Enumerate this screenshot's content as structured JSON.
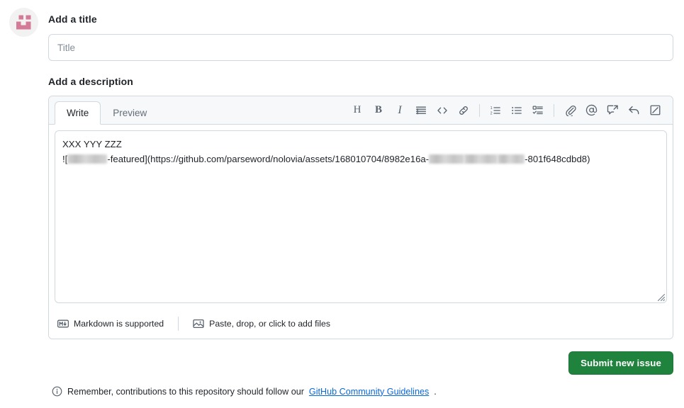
{
  "avatar": {
    "icon": "repository-owner-avatar",
    "bg_color": "#f3f2f2",
    "mark_color": "#d47b97"
  },
  "title_section": {
    "label": "Add a title",
    "input": {
      "value": "",
      "placeholder": "Title",
      "name": "issue-title-input"
    }
  },
  "description_section": {
    "label": "Add a description",
    "tabs": [
      {
        "label": "Write",
        "active": true
      },
      {
        "label": "Preview",
        "active": false
      }
    ],
    "toolbar": [
      {
        "name": "heading-icon",
        "glyph": "H",
        "kind": "letter"
      },
      {
        "name": "bold-icon",
        "glyph": "B",
        "kind": "letter-bold"
      },
      {
        "name": "italic-icon",
        "glyph": "I",
        "kind": "letter-italic"
      },
      {
        "name": "quote-icon",
        "kind": "svg"
      },
      {
        "name": "code-icon",
        "kind": "svg"
      },
      {
        "name": "link-icon",
        "kind": "svg"
      },
      {
        "name": "separator",
        "kind": "sep"
      },
      {
        "name": "ordered-list-icon",
        "kind": "svg"
      },
      {
        "name": "unordered-list-icon",
        "kind": "svg"
      },
      {
        "name": "task-list-icon",
        "kind": "svg"
      },
      {
        "name": "separator",
        "kind": "sep"
      },
      {
        "name": "attach-files-icon",
        "kind": "svg"
      },
      {
        "name": "mention-icon",
        "kind": "svg"
      },
      {
        "name": "saved-replies-icon",
        "kind": "svg"
      },
      {
        "name": "reply-icon",
        "kind": "svg"
      },
      {
        "name": "fullscreen-icon",
        "kind": "svg"
      }
    ],
    "body": {
      "line1": "XXX YYY ZZZ",
      "line2_parts": [
        {
          "type": "text",
          "value": "!["
        },
        {
          "type": "blur",
          "width": "b1"
        },
        {
          "type": "text",
          "value": "-featured](https://github.com/parseword/nolovia/assets/168010704/8982e16a-"
        },
        {
          "type": "blur",
          "width": "b2"
        },
        {
          "type": "blur",
          "width": "b3"
        },
        {
          "type": "blur",
          "width": "b4"
        },
        {
          "type": "text",
          "value": "-801f648cdbd8)"
        }
      ],
      "plain_text": "XXX YYY ZZZ\n![▒▒▒▒-featured](https://github.com/parseword/nolovia/assets/168010704/8982e16a-▒▒▒▒ ▒▒▒▒ ▒▒▒-801f648cdbd8)"
    },
    "footer": {
      "markdown_label": "Markdown is supported",
      "markdown_icon": "markdown-icon",
      "attach_label": "Paste, drop, or click to add files",
      "attach_icon": "image-icon"
    }
  },
  "submit": {
    "label": "Submit new issue",
    "color": "#1f833d"
  },
  "note": {
    "icon": "info-icon",
    "text_before": "Remember, contributions to this repository should follow our ",
    "link_text": "GitHub Community Guidelines",
    "text_after": ".",
    "link_color": "#0969da"
  }
}
